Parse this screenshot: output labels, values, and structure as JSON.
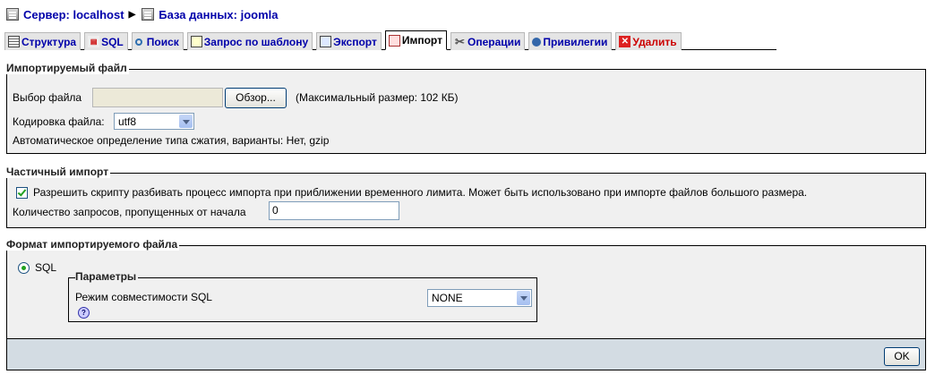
{
  "breadcrumb": {
    "server": "Сервер: localhost",
    "database": "База данных: joomla"
  },
  "tabs": [
    {
      "label": "Структура",
      "icon": "structure-icon"
    },
    {
      "label": "SQL",
      "icon": "sql-icon"
    },
    {
      "label": "Поиск",
      "icon": "search-icon"
    },
    {
      "label": "Запрос по шаблону",
      "icon": "query-icon"
    },
    {
      "label": "Экспорт",
      "icon": "export-icon"
    },
    {
      "label": "Импорт",
      "icon": "import-icon",
      "active": true
    },
    {
      "label": "Операции",
      "icon": "operations-icon"
    },
    {
      "label": "Привилегии",
      "icon": "privileges-icon"
    },
    {
      "label": "Удалить",
      "icon": "delete-icon"
    }
  ],
  "file_section": {
    "legend": "Импортируемый файл",
    "choose_label": "Выбор файла",
    "browse_button": "Обзор...",
    "max_size": "(Максимальный размер: 102 КБ)",
    "charset_label": "Кодировка файла:",
    "charset_value": "utf8",
    "compression_note": "Автоматическое определение типа сжатия, варианты: Нет, gzip"
  },
  "partial_section": {
    "legend": "Частичный импорт",
    "allow_interrupt": "Разрешить скрипту разбивать процесс импорта при приближении временного лимита. Может быть использовано при импорте файлов большого размера.",
    "skip_label": "Количество запросов, пропущенных от начала",
    "skip_value": "0"
  },
  "format_section": {
    "legend": "Формат импортируемого файла",
    "sql_option": "SQL",
    "params_legend": "Параметры",
    "compat_label": "Режим совместимости SQL",
    "compat_value": "NONE"
  },
  "ok_button": "OK"
}
